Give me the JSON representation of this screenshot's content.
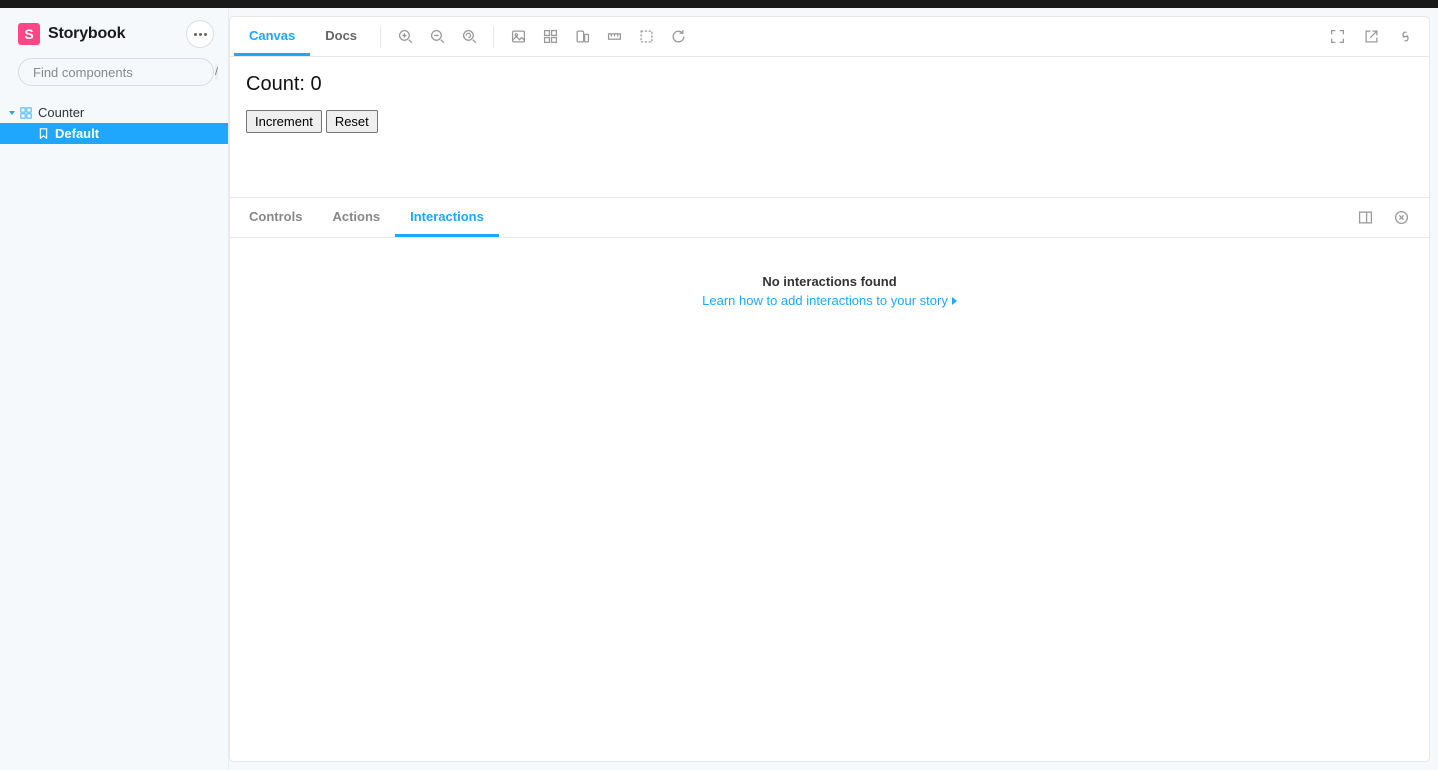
{
  "brand": {
    "name": "Storybook",
    "badge": "S"
  },
  "search": {
    "placeholder": "Find components",
    "shortcut": "/"
  },
  "sidebar": {
    "component": {
      "label": "Counter"
    },
    "story": {
      "label": "Default"
    }
  },
  "toolbar": {
    "tabs": {
      "canvas": "Canvas",
      "docs": "Docs"
    }
  },
  "preview": {
    "count_label": "Count: 0",
    "increment": "Increment",
    "reset": "Reset"
  },
  "addons": {
    "tabs": {
      "controls": "Controls",
      "actions": "Actions",
      "interactions": "Interactions"
    },
    "empty_title": "No interactions found",
    "empty_link": "Learn how to add interactions to your story"
  }
}
